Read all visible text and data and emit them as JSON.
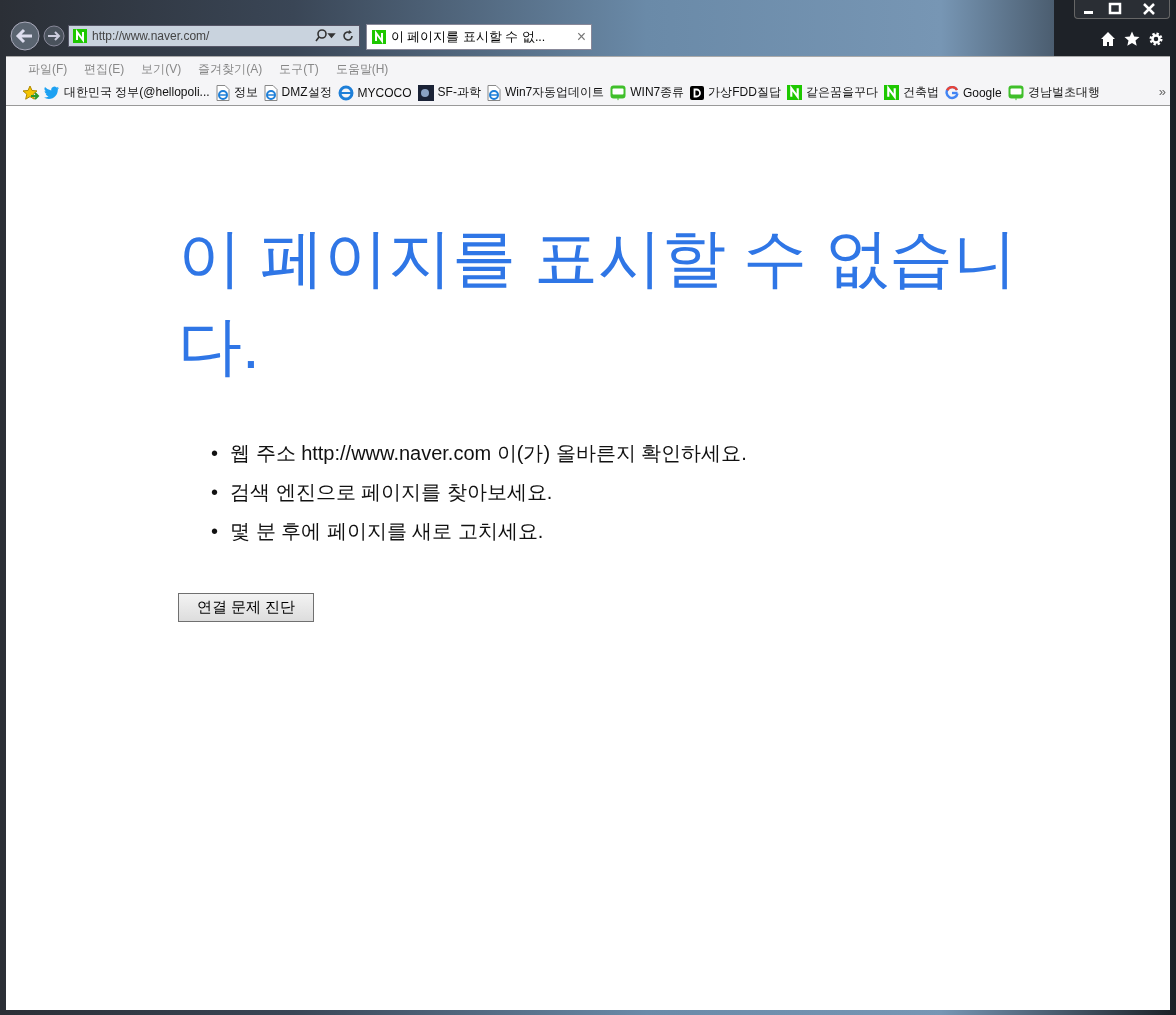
{
  "browser": {
    "address": {
      "value": "http://www.naver.com/"
    },
    "tabs": [
      {
        "label": "이 페이지를 표시할 수 없...",
        "close": "×",
        "selected": true
      }
    ],
    "menu": [
      "파일(F)",
      "편집(E)",
      "보기(V)",
      "즐겨찾기(A)",
      "도구(T)",
      "도움말(H)"
    ],
    "favorites": [
      {
        "label": "대한민국 정부(@hellopoli...",
        "kind": "twitter"
      },
      {
        "label": "정보",
        "kind": "ie-page"
      },
      {
        "label": "DMZ설정",
        "kind": "ie-page"
      },
      {
        "label": "MYCOCO",
        "kind": "ie"
      },
      {
        "label": "SF-과학",
        "kind": "image"
      },
      {
        "label": "Win7자동업데이트",
        "kind": "ie-page"
      },
      {
        "label": "WIN7종류",
        "kind": "blog"
      },
      {
        "label": "가상FDD질답",
        "kind": "dark"
      },
      {
        "label": "같은꿈을꾸다",
        "kind": "naver"
      },
      {
        "label": "건축법",
        "kind": "naver"
      },
      {
        "label": "Google",
        "kind": "google"
      },
      {
        "label": "경남벌초대행",
        "kind": "blog"
      }
    ],
    "more": "»"
  },
  "page": {
    "heading": "이 페이지를 표시할 수 없습니다.",
    "tips": [
      {
        "bullet": "•",
        "text": "웹 주소 http://www.naver.com 이(가) 올바른지 확인하세요."
      },
      {
        "bullet": "•",
        "text": "검색 엔진으로 페이지를 찾아보세요."
      },
      {
        "bullet": "•",
        "text": "몇 분 후에 페이지를 새로 고치세요."
      }
    ],
    "button": "연결 문제 진단"
  }
}
